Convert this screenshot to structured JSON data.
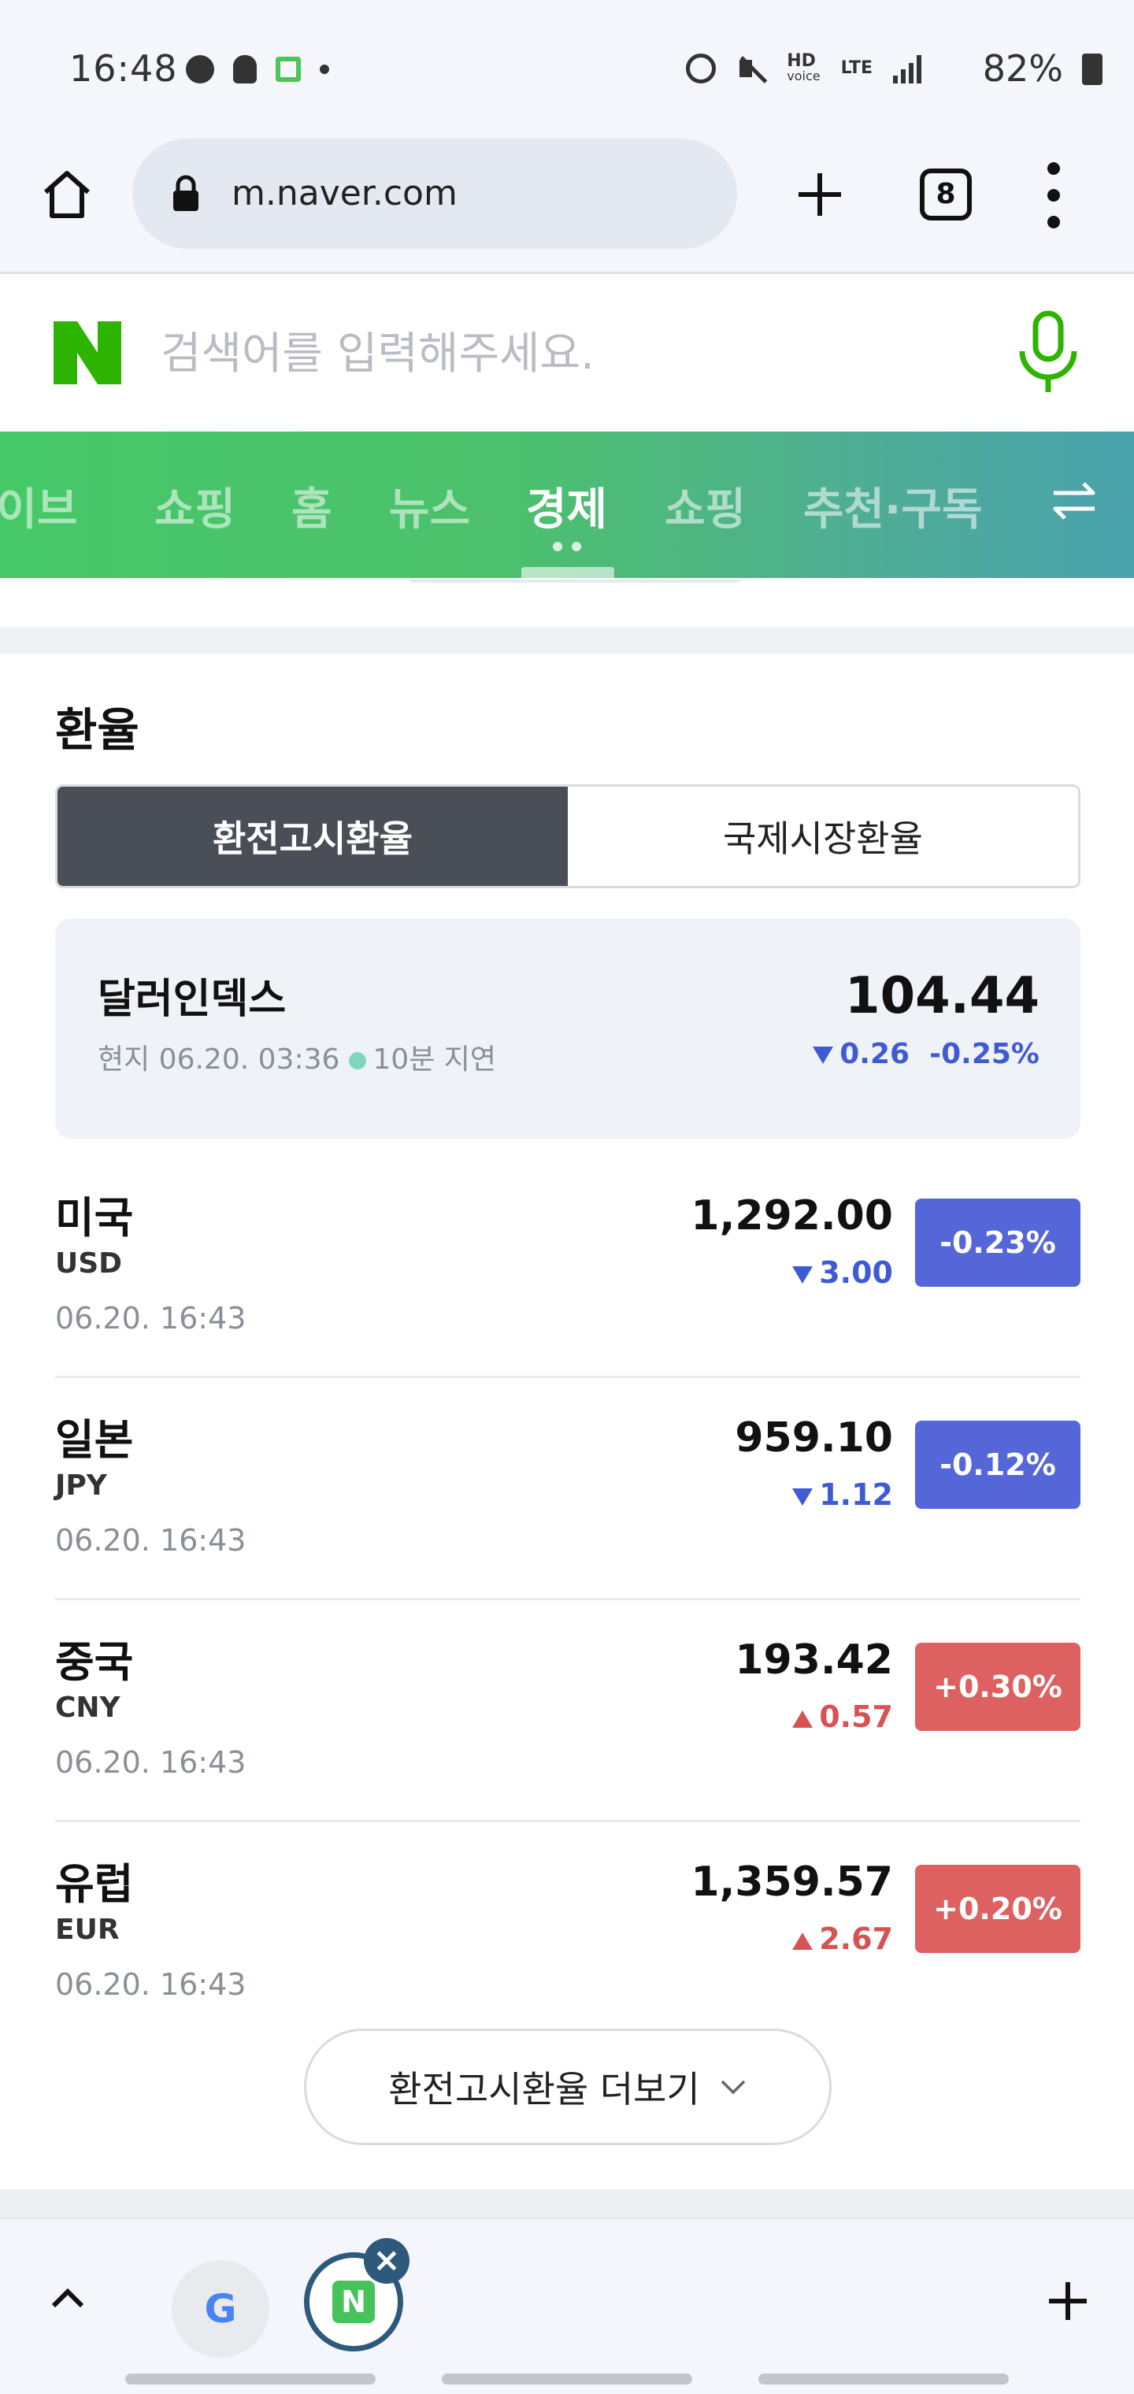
{
  "status_bar": {
    "time": "16:48",
    "battery": "82%",
    "network_label_top": "HD",
    "network_label_sub": "voice",
    "lte_label": "LTE"
  },
  "browser": {
    "url": "m.naver.com",
    "tab_count": "8"
  },
  "search": {
    "placeholder": "검색어를 입력해주세요.",
    "logo_letter": "N",
    "brand_color": "#03c75a"
  },
  "nav_tabs": {
    "items": [
      "라이브",
      "쇼핑",
      "홈",
      "뉴스",
      "경제",
      "쇼핑",
      "추천·구독"
    ],
    "active": "경제"
  },
  "exchange": {
    "title": "환율",
    "segments": [
      "환전고시환율",
      "국제시장환율"
    ],
    "active_segment": "환전고시환율",
    "dollar_index": {
      "name": "달러인덱스",
      "time": "현지 06.20. 03:36",
      "delay": "10분 지연",
      "value": "104.44",
      "change": "0.26",
      "change_pct": "-0.25%"
    },
    "rows": [
      {
        "country": "미국",
        "code": "USD",
        "time": "06.20. 16:43",
        "value": "1,292.00",
        "change": "3.00",
        "direction": "down",
        "pct": "-0.23%"
      },
      {
        "country": "일본",
        "code": "JPY",
        "time": "06.20. 16:43",
        "value": "959.10",
        "change": "1.12",
        "direction": "down",
        "pct": "-0.12%"
      },
      {
        "country": "중국",
        "code": "CNY",
        "time": "06.20. 16:43",
        "value": "193.42",
        "change": "0.57",
        "direction": "up",
        "pct": "+0.30%"
      },
      {
        "country": "유럽",
        "code": "EUR",
        "time": "06.20. 16:43",
        "value": "1,359.57",
        "change": "2.67",
        "direction": "up",
        "pct": "+0.20%"
      }
    ],
    "more_label": "환전고시환율 더보기"
  },
  "bottom_bar": {
    "google_letter": "G",
    "naver_letter": "N",
    "close_glyph": "×"
  },
  "colors": {
    "down": "#3f5bd3",
    "up": "#d65353",
    "badge_down": "#5567d8",
    "badge_up": "#de6161",
    "segment_active": "#4a4e57"
  }
}
